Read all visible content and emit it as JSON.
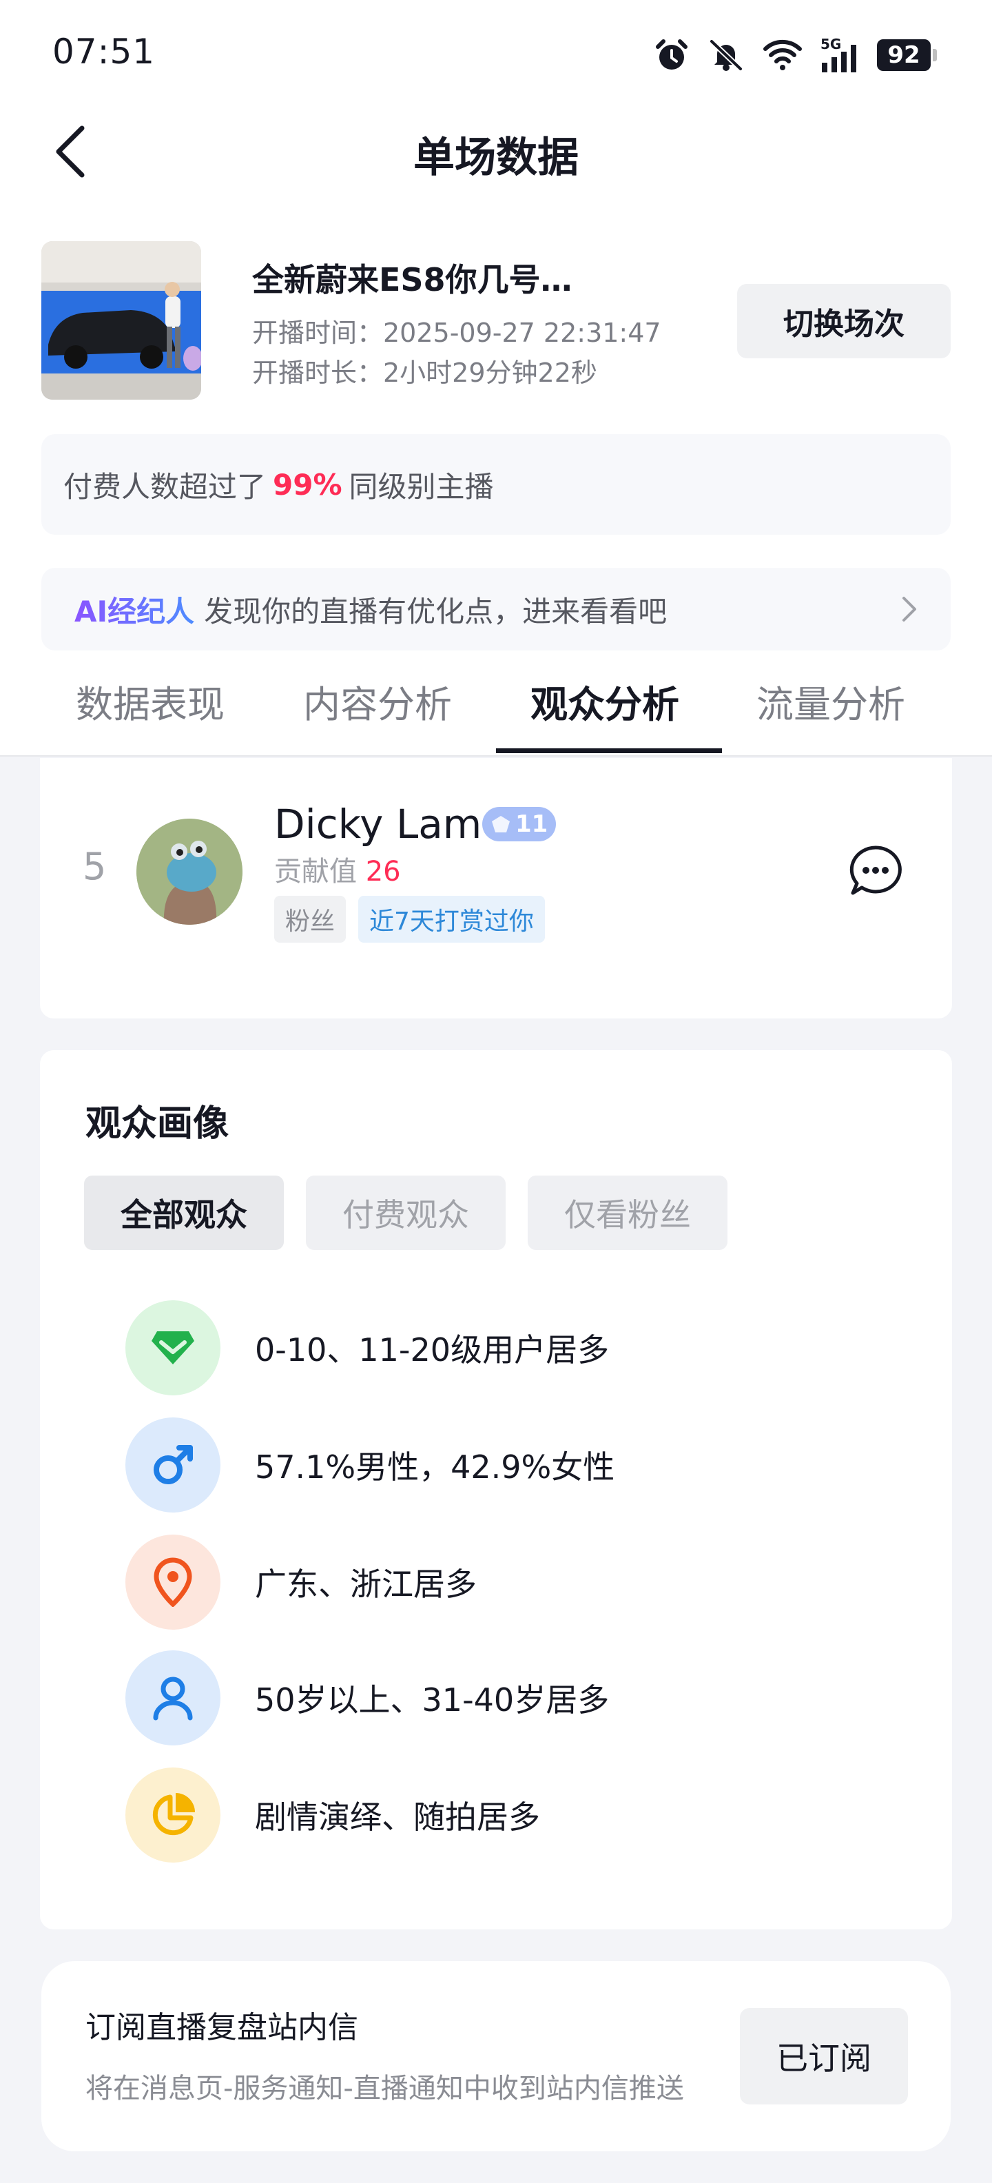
{
  "status_bar": {
    "time": "07:51",
    "battery": "92",
    "network": "5G"
  },
  "nav": {
    "title": "单场数据"
  },
  "session": {
    "title": "全新蔚来ES8你几号…",
    "start_time": "开播时间：2025-09-27 22:31:47",
    "duration": "开播时长：2小时29分钟22秒",
    "switch_label": "切换场次"
  },
  "paid_banner": {
    "prefix": "付费人数超过了",
    "percent": "99%",
    "suffix": "同级别主播"
  },
  "ai_banner": {
    "tag": "AI经纪人",
    "text": "发现你的直播有优化点，进来看看吧"
  },
  "tabs": [
    {
      "label": "数据表现"
    },
    {
      "label": "内容分析"
    },
    {
      "label": "观众分析"
    },
    {
      "label": "流量分析"
    }
  ],
  "contributor": {
    "rank": "5",
    "name": "Dicky Lam",
    "level": "11",
    "contribution_label": "贡献值",
    "contribution_value": "26",
    "tags": [
      "粉丝",
      "近7天打赏过你"
    ]
  },
  "audience_profile": {
    "title": "观众画像",
    "filters": [
      "全部观众",
      "付费观众",
      "仅看粉丝"
    ],
    "rows": [
      {
        "icon": "diamond-icon",
        "text": "0-10、11-20级用户居多",
        "color": "#22b14c",
        "bg": "#dcf6e0"
      },
      {
        "icon": "male-icon",
        "text": "57.1%男性，42.9%女性",
        "color": "#1e7ee6",
        "bg": "#dceafc"
      },
      {
        "icon": "location-pin-icon",
        "text": "广东、浙江居多",
        "color": "#f0541e",
        "bg": "#fde6dd"
      },
      {
        "icon": "person-icon",
        "text": "50岁以上、31-40岁居多",
        "color": "#1e7ee6",
        "bg": "#dceafc"
      },
      {
        "icon": "pie-chart-icon",
        "text": "剧情演绎、随拍居多",
        "color": "#f5b300",
        "bg": "#fdf0cf"
      }
    ]
  },
  "subscribe": {
    "title": "订阅直播复盘站内信",
    "desc": "将在消息页-服务通知-直播通知中收到站内信推送",
    "button": "已订阅"
  }
}
